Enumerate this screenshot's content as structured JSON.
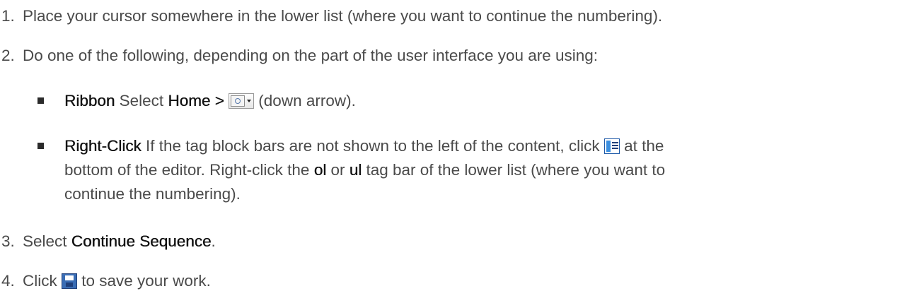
{
  "steps": [
    {
      "number": "1.",
      "text": "Place your cursor somewhere in the lower list (where you want to continue the numbering)."
    },
    {
      "number": "2.",
      "text": "Do one of the following, depending on the part of the user interface you are using:",
      "options": [
        {
          "label": "Ribbon",
          "text_before": " Select ",
          "menu_path": "Home >",
          "text_after": " (down arrow).",
          "icon": "continue-list-dropdown-icon"
        },
        {
          "label": "Right-Click",
          "line1_before": " If the tag block bars are not shown to the left of the content, click ",
          "line1_after": " at the",
          "icon": "show-tag-block-bars-icon",
          "line2_before": "bottom of the editor. Right-click the ",
          "tag_ol": "ol",
          "or_text": " or ",
          "tag_ul": "ul",
          "line2_after": " tag bar of the lower list (where you want to",
          "line3": "continue the numbering)."
        }
      ]
    },
    {
      "number": "3.",
      "text_before": "Select ",
      "command": "Continue Sequence",
      "text_after": "."
    },
    {
      "number": "4.",
      "text_before": "Click ",
      "icon": "save-icon",
      "text_after": " to save your work."
    }
  ]
}
